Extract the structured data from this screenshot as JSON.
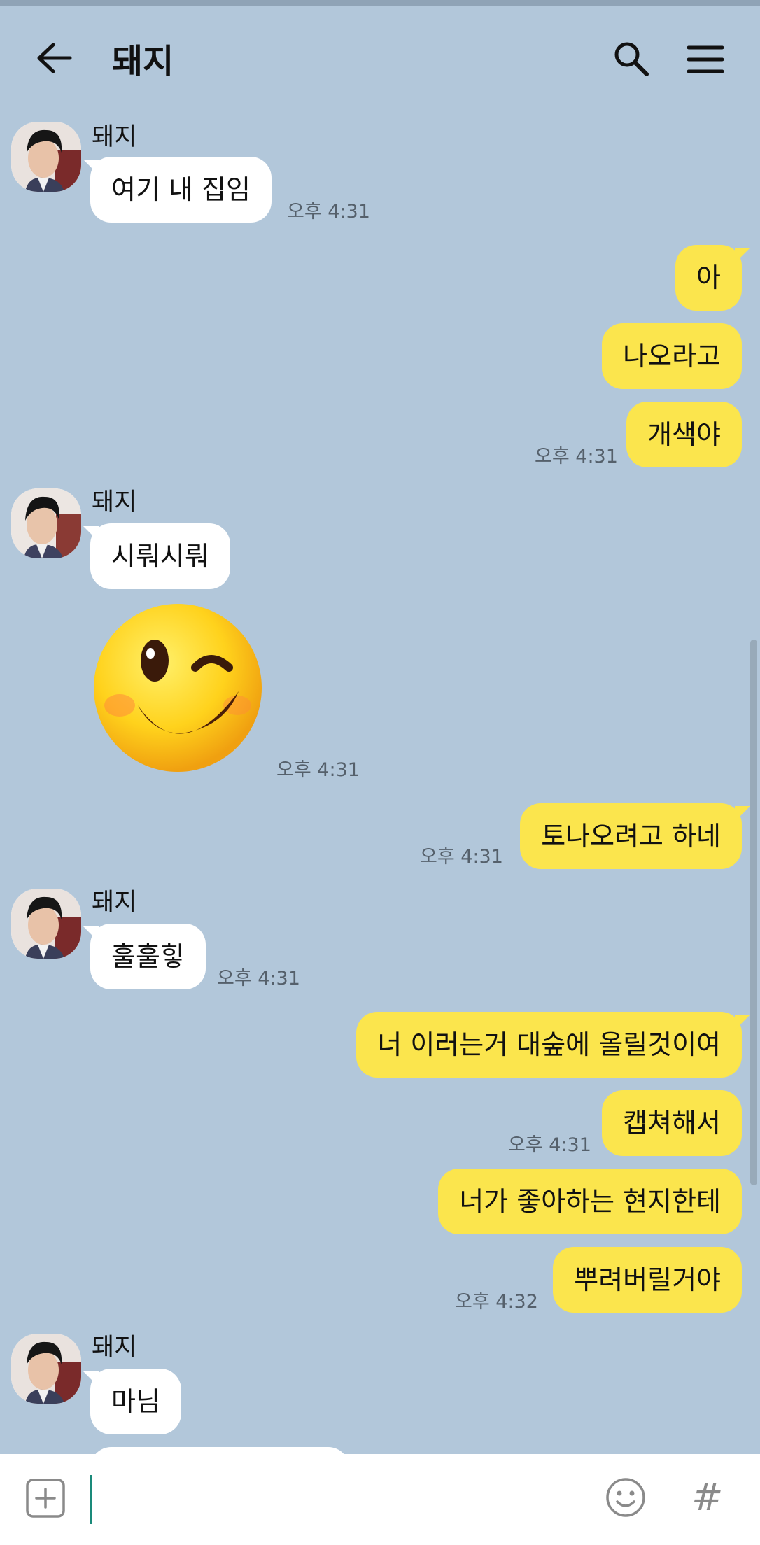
{
  "header": {
    "title": "돼지",
    "icons": {
      "back": "arrow-left-icon",
      "search": "search-icon",
      "menu": "hamburger-menu-icon"
    }
  },
  "messages": [
    {
      "dir": "in",
      "sender": "돼지",
      "text": "여기 내 집임",
      "time": "오후 4:31"
    },
    {
      "dir": "out",
      "text": "아"
    },
    {
      "dir": "out",
      "text": "나오라고"
    },
    {
      "dir": "out",
      "text": "개색야",
      "time": "오후 4:31"
    },
    {
      "dir": "in",
      "sender": "돼지",
      "text": "시뤄시뤄"
    },
    {
      "dir": "in",
      "type": "emoticon",
      "emoticon": "winking-face-emoticon",
      "time": "오후 4:31"
    },
    {
      "dir": "out",
      "text": "토나오려고 하네",
      "time": "오후 4:31"
    },
    {
      "dir": "in",
      "sender": "돼지",
      "text": "훌훌힣",
      "time": "오후 4:31"
    },
    {
      "dir": "out",
      "text": "너 이러는거 대숲에 올릴것이여"
    },
    {
      "dir": "out",
      "text": "캡쳐해서",
      "time": "오후 4:31"
    },
    {
      "dir": "out",
      "text": "너가 좋아하는 현지한테"
    },
    {
      "dir": "out",
      "text": "뿌려버릴거야",
      "time": "오후 4:32"
    },
    {
      "dir": "in",
      "sender": "돼지",
      "text": "마님"
    }
  ],
  "input": {
    "value": "",
    "icons": {
      "add": "plus-square-icon",
      "emoticon": "smiley-icon",
      "hash": "hash-icon"
    },
    "hash_glyph": "#"
  },
  "colors": {
    "background": "#b2c7da",
    "outgoing_bubble": "#fbe54d",
    "incoming_bubble": "#ffffff",
    "cursor": "#1a8a7a"
  }
}
